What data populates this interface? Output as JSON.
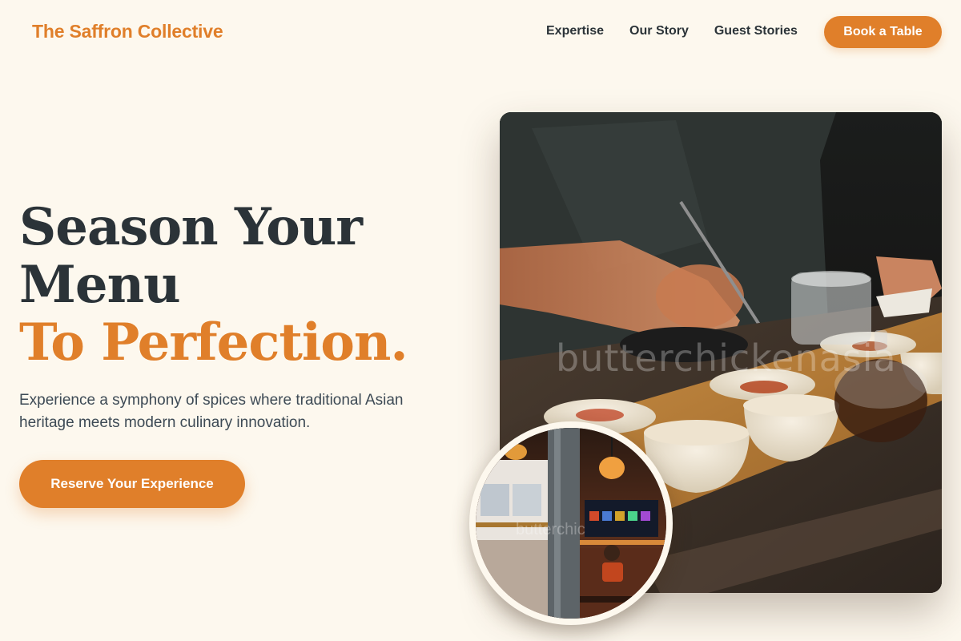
{
  "nav": {
    "brand": "The Saffron Collective",
    "links": [
      "Expertise",
      "Our Story",
      "Guest Stories"
    ],
    "cta": "Book a Table"
  },
  "hero": {
    "headline_line1": "Season Your",
    "headline_line2": "Menu",
    "headline_accent": "To Perfection.",
    "subtext": "Experience a symphony of spices where traditional Asian heritage meets modern culinary innovation.",
    "cta": "Reserve Your Experience"
  },
  "images": {
    "main_watermark": "butterchickenasia",
    "inset_watermark": "butterchic"
  },
  "colors": {
    "accent": "#e07f2a",
    "background": "#fdf8ee",
    "text": "#2b3338"
  }
}
